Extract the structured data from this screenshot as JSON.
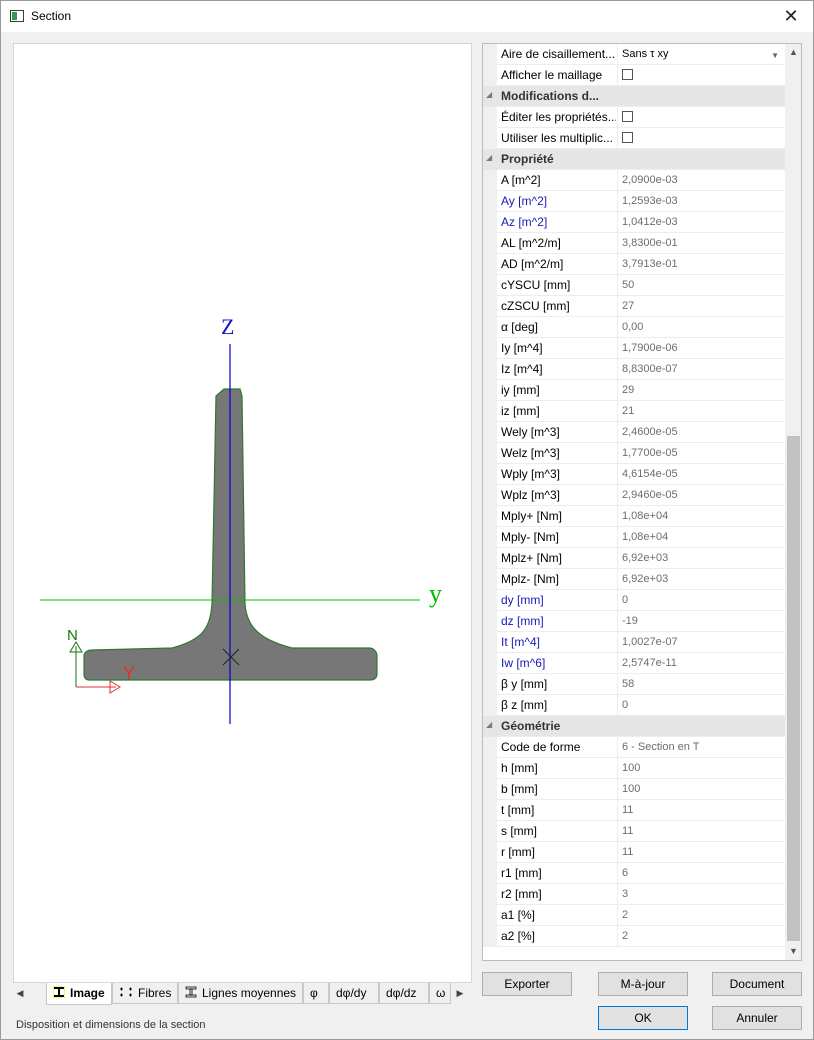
{
  "window": {
    "title": "Section",
    "close_glyph": "✕"
  },
  "drawing": {
    "axis_z_label": "Z",
    "axis_y_label": "y",
    "local_n_label": "N",
    "local_y_label": "Y"
  },
  "tabs": [
    {
      "label": "Image",
      "icon": "i-beam-icon"
    },
    {
      "label": "Fibres",
      "icon": "fibres-icon"
    },
    {
      "label": "Lignes moyennes",
      "icon": "i-beam-icon"
    },
    {
      "label": "φ"
    },
    {
      "label": "dφ/dy"
    },
    {
      "label": "dφ/dz"
    },
    {
      "label": "ω"
    }
  ],
  "status": "Disposition et dimensions de la section",
  "grid": {
    "rows": [
      {
        "kind": "prop",
        "name": "Aire de cisaillement...",
        "value": "Sans τ xy",
        "dark": true,
        "dropdown": true
      },
      {
        "kind": "prop",
        "name": "Afficher le maillage",
        "checkbox": true
      },
      {
        "kind": "cat",
        "name": "Modifications d..."
      },
      {
        "kind": "prop",
        "name": "Éditer les propriétés...",
        "checkbox": true
      },
      {
        "kind": "prop",
        "name": "Utiliser les multiplic...",
        "checkbox": true
      },
      {
        "kind": "cat",
        "name": "Propriété"
      },
      {
        "kind": "prop",
        "name": "A [m^2]",
        "value": "2,0900e-03"
      },
      {
        "kind": "prop",
        "name": "Ay [m^2]",
        "value": "1,2593e-03",
        "blue": true
      },
      {
        "kind": "prop",
        "name": "Az [m^2]",
        "value": "1,0412e-03",
        "blue": true
      },
      {
        "kind": "prop",
        "name": "AL [m^2/m]",
        "value": "3,8300e-01"
      },
      {
        "kind": "prop",
        "name": "AD [m^2/m]",
        "value": "3,7913e-01"
      },
      {
        "kind": "prop",
        "name": "cYSCU [mm]",
        "value": "50"
      },
      {
        "kind": "prop",
        "name": "cZSCU [mm]",
        "value": "27"
      },
      {
        "kind": "prop",
        "name": "α [deg]",
        "value": "0,00"
      },
      {
        "kind": "prop",
        "name": "Iy [m^4]",
        "value": "1,7900e-06"
      },
      {
        "kind": "prop",
        "name": "Iz [m^4]",
        "value": "8,8300e-07"
      },
      {
        "kind": "prop",
        "name": "iy [mm]",
        "value": "29"
      },
      {
        "kind": "prop",
        "name": "iz [mm]",
        "value": "21"
      },
      {
        "kind": "prop",
        "name": "Wely [m^3]",
        "value": "2,4600e-05"
      },
      {
        "kind": "prop",
        "name": "Welz [m^3]",
        "value": "1,7700e-05"
      },
      {
        "kind": "prop",
        "name": "Wply [m^3]",
        "value": "4,6154e-05"
      },
      {
        "kind": "prop",
        "name": "Wplz [m^3]",
        "value": "2,9460e-05"
      },
      {
        "kind": "prop",
        "name": "Mply+ [Nm]",
        "value": "1,08e+04"
      },
      {
        "kind": "prop",
        "name": "Mply- [Nm]",
        "value": "1,08e+04"
      },
      {
        "kind": "prop",
        "name": "Mplz+ [Nm]",
        "value": "6,92e+03"
      },
      {
        "kind": "prop",
        "name": "Mplz- [Nm]",
        "value": "6,92e+03"
      },
      {
        "kind": "prop",
        "name": "dy [mm]",
        "value": "0",
        "blue": true
      },
      {
        "kind": "prop",
        "name": "dz [mm]",
        "value": "-19",
        "blue": true
      },
      {
        "kind": "prop",
        "name": "It [m^4]",
        "value": "1,0027e-07",
        "blue": true
      },
      {
        "kind": "prop",
        "name": "Iw [m^6]",
        "value": "2,5747e-11",
        "blue": true
      },
      {
        "kind": "prop",
        "name": "β y [mm]",
        "value": "58"
      },
      {
        "kind": "prop",
        "name": "β z [mm]",
        "value": "0"
      },
      {
        "kind": "cat",
        "name": "Géométrie"
      },
      {
        "kind": "prop",
        "name": "Code de forme",
        "value": "6 - Section en T"
      },
      {
        "kind": "prop",
        "name": "h [mm]",
        "value": "100"
      },
      {
        "kind": "prop",
        "name": "b [mm]",
        "value": "100"
      },
      {
        "kind": "prop",
        "name": "t [mm]",
        "value": "11"
      },
      {
        "kind": "prop",
        "name": "s [mm]",
        "value": "11"
      },
      {
        "kind": "prop",
        "name": "r [mm]",
        "value": "11"
      },
      {
        "kind": "prop",
        "name": "r1 [mm]",
        "value": "6"
      },
      {
        "kind": "prop",
        "name": "r2 [mm]",
        "value": "3"
      },
      {
        "kind": "prop",
        "name": "a1 [%]",
        "value": "2"
      },
      {
        "kind": "prop",
        "name": "a2 [%]",
        "value": "2"
      }
    ]
  },
  "buttons": {
    "export": "Exporter",
    "update": "M-à-jour",
    "document": "Document",
    "ok": "OK",
    "cancel": "Annuler"
  }
}
